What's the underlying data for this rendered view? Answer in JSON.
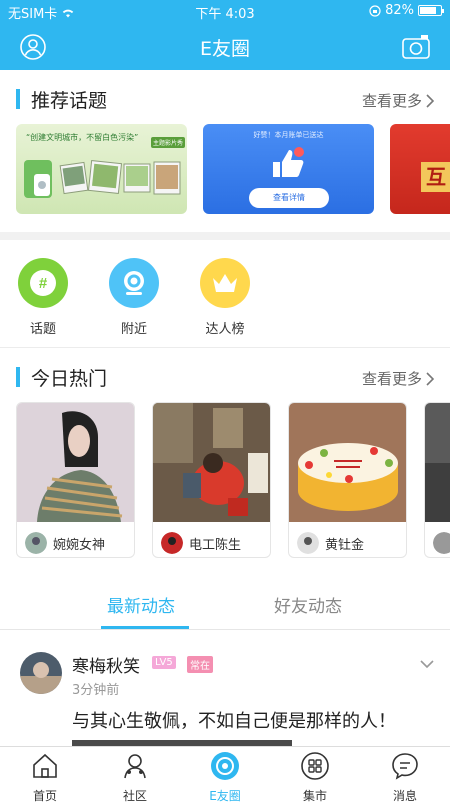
{
  "status": {
    "carrier": "无SIM卡",
    "time": "下午 4:03",
    "battery": "82%",
    "battery_level": 0.82
  },
  "header": {
    "title": "E友圈",
    "left_icon": "profile-icon",
    "right_icon": "camera-icon"
  },
  "recommend": {
    "title": "推荐话题",
    "more": "查看更多",
    "banners": [
      {
        "caption": "“创建文明城市，不留白色污染”",
        "tag": "主题影片秀"
      },
      {
        "top": "好赞！本月账单已送达",
        "button": "查看详情"
      },
      {
        "text": "互"
      }
    ]
  },
  "entries": [
    {
      "label": "话题",
      "icon": "hash-icon",
      "color": "#7fd13b"
    },
    {
      "label": "附近",
      "icon": "location-icon",
      "color": "#4fc3f7"
    },
    {
      "label": "达人榜",
      "icon": "crown-icon",
      "color": "#ffd84d"
    }
  ],
  "hot": {
    "title": "今日热门",
    "more": "查看更多",
    "cards": [
      {
        "name": "婉婉女神"
      },
      {
        "name": "电工陈生"
      },
      {
        "name": "黄钍金"
      }
    ]
  },
  "feed_tabs": [
    "最新动态",
    "好友动态"
  ],
  "post": {
    "name": "寒梅秋笑",
    "level": "LV5",
    "badge": "常在",
    "time": "3分钟前",
    "text": "与其心生敬佩，不如自己便是那样的人！"
  },
  "tabbar": [
    {
      "label": "首页",
      "icon": "home-icon"
    },
    {
      "label": "社区",
      "icon": "community-icon"
    },
    {
      "label": "E友圈",
      "icon": "circle-icon"
    },
    {
      "label": "集市",
      "icon": "market-icon"
    },
    {
      "label": "消息",
      "icon": "message-icon"
    }
  ]
}
